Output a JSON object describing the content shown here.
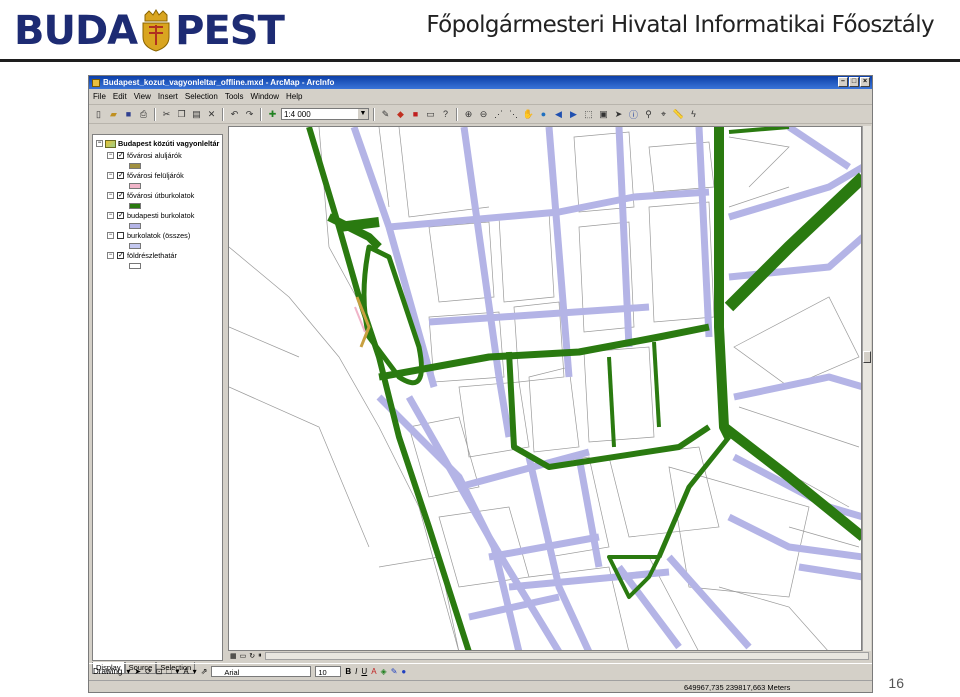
{
  "slide": {
    "logo_left": "BUDA",
    "logo_right": "PEST",
    "department": "Főpolgármesteri Hivatal Informatikai Főosztály",
    "page_number": "16",
    "colors": {
      "logo_blue": "#1d2b73",
      "crest_gold": "#d9a520"
    }
  },
  "window": {
    "title": "Budapest_kozut_vagyonleltar_offline.mxd - ArcMap - ArcInfo",
    "buttons": [
      "minimize",
      "maximize",
      "close"
    ]
  },
  "menu": [
    "File",
    "Edit",
    "View",
    "Insert",
    "Selection",
    "Tools",
    "Window",
    "Help"
  ],
  "toolbar": {
    "scale": "1:4 000",
    "icons": [
      "new-icon",
      "open-icon",
      "save-icon",
      "print-icon",
      "cut-icon",
      "copy-icon",
      "paste-icon",
      "delete-icon",
      "undo-icon",
      "redo-icon",
      "add-data-icon",
      "editor-icon",
      "arctoolbox-icon",
      "layout-icon",
      "layer-icon",
      "help-icon",
      "zoom-in-icon",
      "zoom-out-icon",
      "fixed-zoom-in-icon",
      "fixed-zoom-out-icon",
      "pan-icon",
      "full-extent-icon",
      "back-icon",
      "forward-icon",
      "select-icon",
      "clear-selection-icon",
      "select-elements-icon",
      "identify-icon",
      "find-icon",
      "goto-xy-icon",
      "measure-icon",
      "hyperlink-icon"
    ]
  },
  "toc": {
    "root_label": "Budapest közúti vagyonleltár",
    "layers": [
      {
        "label": "fővárosi aluljárók",
        "checked": true,
        "swatch": "#a09040"
      },
      {
        "label": "fővárosi felüljárók",
        "checked": true,
        "swatch": "#f0b4c8"
      },
      {
        "label": "fővárosi útburkolatok",
        "checked": true,
        "swatch": "#2a7a10"
      },
      {
        "label": "budapesti burkolatok",
        "checked": true,
        "swatch": "#b4b4e6"
      },
      {
        "label": "burkolatok (összes)",
        "checked": false,
        "swatch": "#c4c8f0"
      },
      {
        "label": "földrészlethatár",
        "checked": true,
        "swatch": "#ffffff"
      }
    ],
    "tabs": [
      "Display",
      "Source",
      "Selection"
    ]
  },
  "drawing": {
    "label": "Drawing",
    "font": "Arial",
    "size": "10",
    "bold": "B",
    "italic": "I",
    "underline": "U"
  },
  "status": {
    "coords": "649967,735  239817,663 Meters"
  },
  "map": {
    "road_color": "#2a7a10",
    "pavement_color": "#b4b4e6",
    "parcel_color": "#999999",
    "overpass_color": "#c8a040"
  }
}
